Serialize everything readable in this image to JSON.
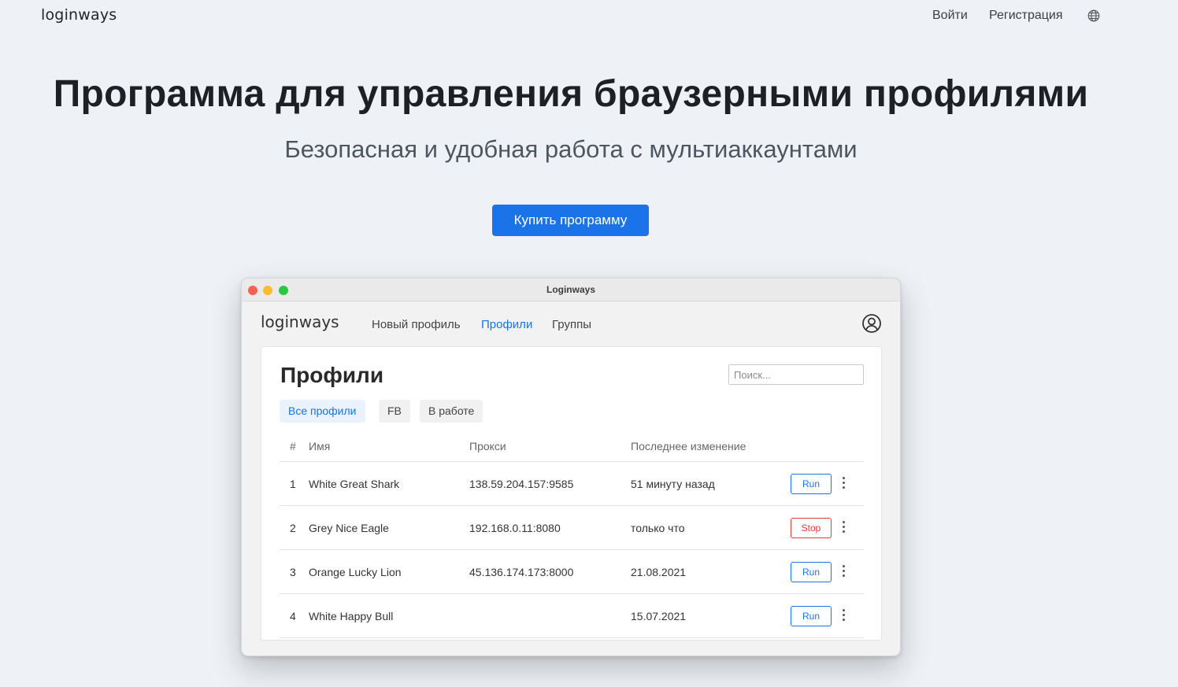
{
  "header": {
    "logo": "loginways",
    "login": "Войти",
    "register": "Регистрация",
    "language_icon": "globe-icon"
  },
  "hero": {
    "title": "Программа для управления браузерными профилями",
    "subtitle": "Безопасная и удобная работа с мультиаккаунтами",
    "buy_button": "Купить программу",
    "accent_color": "#1a73e8"
  },
  "app_window": {
    "title": "Loginways",
    "logo": "loginways",
    "nav": {
      "new_profile": "Новый профиль",
      "profiles": "Профили",
      "groups": "Группы"
    },
    "user_icon": "user-circle-icon",
    "panel": {
      "title": "Профили",
      "search_placeholder": "Поиск...",
      "filters": [
        "Все профили",
        "FB",
        "В работе"
      ],
      "columns": [
        "#",
        "Имя",
        "Прокси",
        "Последнее изменение"
      ],
      "rows": [
        {
          "num": "1",
          "name": "White Great Shark",
          "proxy": "138.59.204.157:9585",
          "modified": "51 минуту назад",
          "action": "Run"
        },
        {
          "num": "2",
          "name": "Grey Nice Eagle",
          "proxy": "192.168.0.11:8080",
          "modified": "только что",
          "action": "Stop"
        },
        {
          "num": "3",
          "name": "Orange Lucky Lion",
          "proxy": "45.136.174.173:8000",
          "modified": "21.08.2021",
          "action": "Run"
        },
        {
          "num": "4",
          "name": "White Happy Bull",
          "proxy": "",
          "modified": "15.07.2021",
          "action": "Run"
        }
      ]
    }
  }
}
